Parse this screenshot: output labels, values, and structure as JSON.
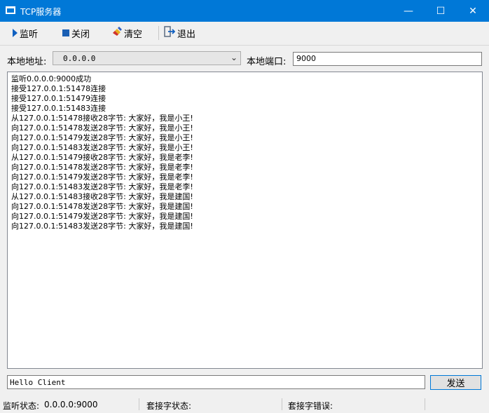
{
  "window": {
    "title": "TCP服务器",
    "minimize_glyph": "—",
    "maximize_glyph": "☐",
    "close_glyph": "✕"
  },
  "toolbar": {
    "listen_label": "监听",
    "close_label": "关闭",
    "clear_label": "清空",
    "exit_label": "退出"
  },
  "address": {
    "local_address_label": "本地地址:",
    "local_address_value": "0.0.0.0",
    "local_port_label": "本地端口:",
    "local_port_value": "9000"
  },
  "log": [
    "监听0.0.0.0:9000成功",
    "接受127.0.0.1:51478连接",
    "接受127.0.0.1:51479连接",
    "接受127.0.0.1:51483连接",
    "从127.0.0.1:51478接收28字节: 大家好，我是小王!",
    "向127.0.0.1:51478发送28字节: 大家好，我是小王!",
    "向127.0.0.1:51479发送28字节: 大家好，我是小王!",
    "向127.0.0.1:51483发送28字节: 大家好，我是小王!",
    "从127.0.0.1:51479接收28字节: 大家好，我是老李!",
    "向127.0.0.1:51478发送28字节: 大家好，我是老李!",
    "向127.0.0.1:51479发送28字节: 大家好，我是老李!",
    "向127.0.0.1:51483发送28字节: 大家好，我是老李!",
    "从127.0.0.1:51483接收28字节: 大家好，我是建国!",
    "向127.0.0.1:51478发送28字节: 大家好，我是建国!",
    "向127.0.0.1:51479发送28字节: 大家好，我是建国!",
    "向127.0.0.1:51483发送28字节: 大家好，我是建国!"
  ],
  "send": {
    "message_value": "Hello Client",
    "send_label": "发送"
  },
  "status": {
    "listen_status_label": "监听状态:",
    "listen_status_value": "0.0.0.0:9000",
    "socket_status_label": "套接字状态:",
    "socket_error_label": "套接字错误:"
  },
  "colors": {
    "titlebar": "#0078d7",
    "accent": "#1060c0"
  },
  "icons": {
    "listen": "play-icon",
    "close": "stop-icon",
    "clear": "eraser-icon",
    "exit": "exit-icon"
  }
}
